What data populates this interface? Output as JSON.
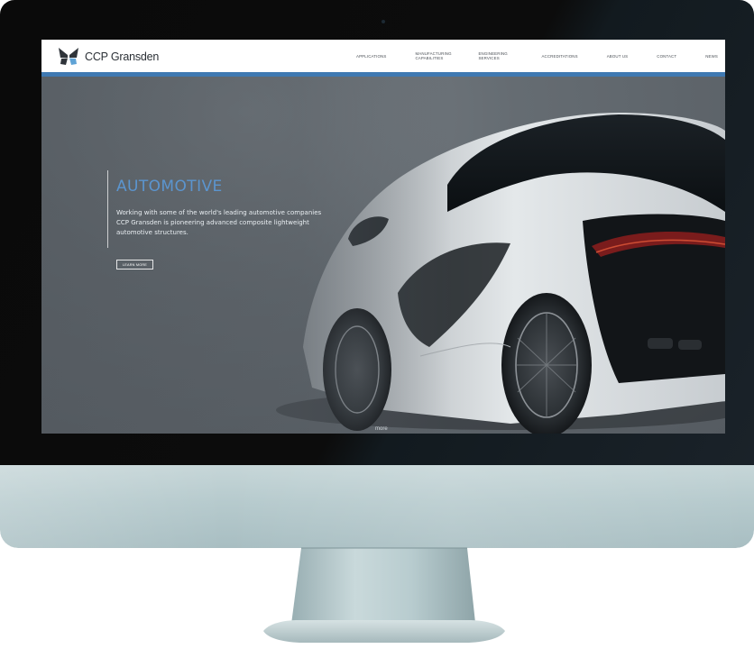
{
  "site": {
    "brand": "CCP Gransden",
    "nav": [
      {
        "label": "APPLICATIONS",
        "two_line": false
      },
      {
        "label": "MANUFACTURING CAPABILITIES",
        "two_line": true
      },
      {
        "label": "ENGINEERING SERVICES",
        "two_line": true
      },
      {
        "label": "ACCREDITATIONS",
        "two_line": false
      },
      {
        "label": "ABOUT US",
        "two_line": false
      },
      {
        "label": "CONTACT",
        "two_line": false
      },
      {
        "label": "NEWS",
        "two_line": false
      }
    ],
    "hero": {
      "title": "AUTOMOTIVE",
      "text": "Working with some of the world's leading automotive companies CCP Gransden is pioneering advanced composite lightweight automotive structures.",
      "button_label": "LEARN MORE",
      "more_label": "more"
    }
  },
  "colors": {
    "accent": "#3f79b2",
    "title": "#5b95cf",
    "logo_dark": "#2f343a",
    "logo_light": "#5fa3d6"
  }
}
